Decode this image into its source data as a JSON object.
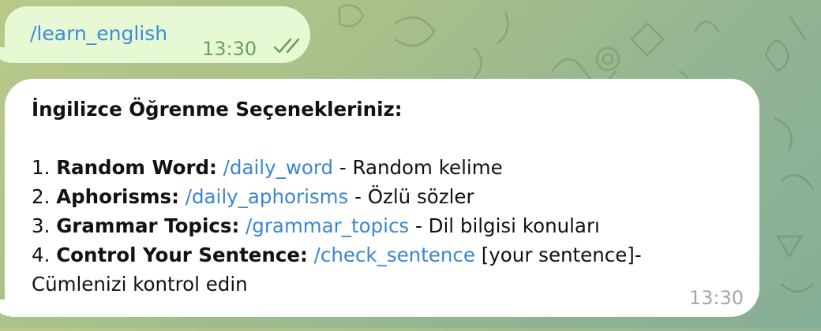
{
  "outgoing": {
    "command": "/learn_english",
    "time": "13:30",
    "status_icon": "double-check-icon"
  },
  "incoming": {
    "title": "İngilizce Öğrenme Seçenekleriniz:",
    "items": [
      {
        "num": "1.",
        "label": "Random Word:",
        "command": "/daily_word",
        "desc": " - Random kelime"
      },
      {
        "num": "2.",
        "label": "Aphorisms:",
        "command": "/daily_aphorisms",
        "desc": " - Özlü sözler"
      },
      {
        "num": "3.",
        "label": "Grammar Topics:",
        "command": "/grammar_topics",
        "desc": " - Dil bilgisi konuları"
      },
      {
        "num": "4.",
        "label": "Control Your Sentence:",
        "command": "/check_sentence",
        "desc": " [your sentence]-"
      }
    ],
    "desc_continued": "Cümlenizi kontrol edin",
    "time": "13:30"
  },
  "colors": {
    "link": "#3a86d0",
    "outgoing_bubble": "#e7f9d4",
    "outgoing_time": "#6da065",
    "incoming_time": "#a3a7ab"
  }
}
